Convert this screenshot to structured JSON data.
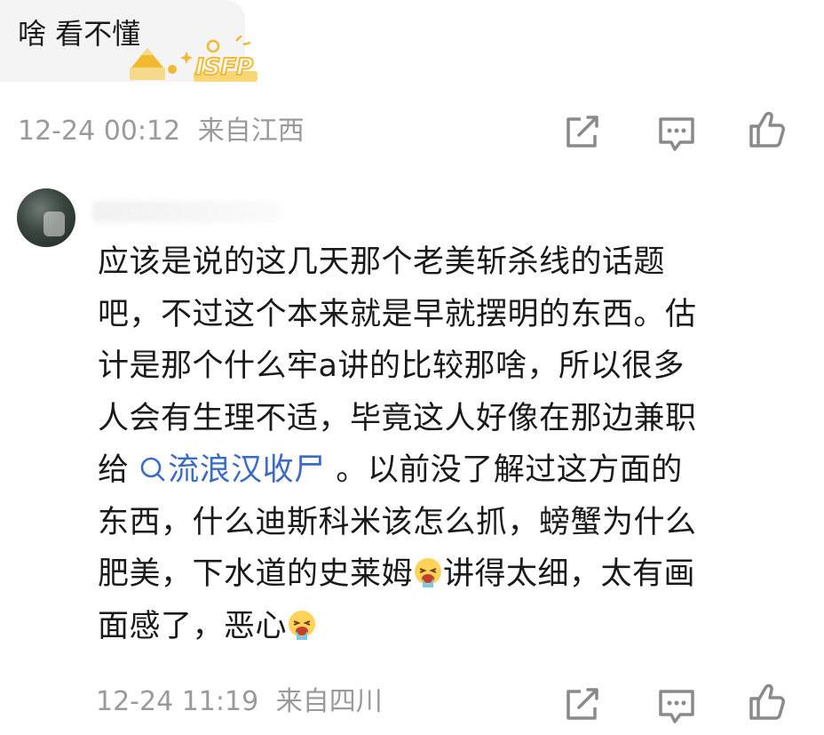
{
  "reply": {
    "text": "啥 看不懂",
    "badge_text": "ISFP",
    "timestamp": "12-24 00:12",
    "location": "来自江西"
  },
  "comment": {
    "timestamp": "12-24 11:19",
    "location": "来自四川",
    "lines": {
      "l1": "应该是说的这几天那个老美斩杀线的话题",
      "l2": "吧，不过这个本来就是早就摆明的东西。估",
      "l3": "计是那个什么牢a讲的比较那啥，所以很多",
      "l4": "人会有生理不适，毕竟这人好像在那边兼职",
      "l5_pre": "给 ",
      "l5_topic": "流浪汉收尸",
      "l5_post": " 。以前没了解过这方面的",
      "l6": "东西，什么迪斯科米该怎么抓，螃蟹为什么",
      "l7_pre": "肥美，下水道的史莱姆",
      "l7_post": "讲得太细，太有画",
      "l8_pre": "面感了，恶心"
    }
  },
  "icons": {
    "share": "share-icon",
    "comment": "comment-icon",
    "like": "like-icon",
    "emoji": "vomit-emoji-icon",
    "topic": "search-icon"
  },
  "colors": {
    "topic_link": "#3a6bc9",
    "meta_gray": "#9a9a9a",
    "badge_gold": "#f2b931"
  }
}
